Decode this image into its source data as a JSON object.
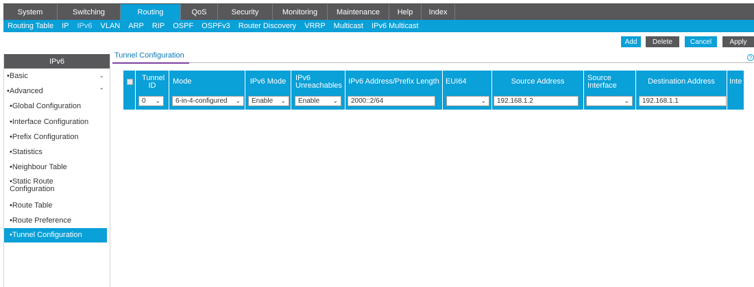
{
  "top_nav": [
    "System",
    "Switching",
    "Routing",
    "QoS",
    "Security",
    "Monitoring",
    "Maintenance",
    "Help",
    "Index"
  ],
  "sub_nav": [
    "Routing Table",
    "IP",
    "IPv6",
    "VLAN",
    "ARP",
    "RIP",
    "OSPF",
    "OSPFv3",
    "Router Discovery",
    "VRRP",
    "Multicast",
    "IPv6 Multicast"
  ],
  "actions": {
    "add": "Add",
    "delete": "Delete",
    "cancel": "Cancel",
    "apply": "Apply"
  },
  "sidebar": {
    "title": "IPv6",
    "groups": [
      "Basic",
      "Advanced"
    ],
    "items": [
      "Global Configuration",
      "Interface Configuration",
      "Prefix Configuration",
      "Statistics",
      "Neighbour Table",
      "Static Route Configuration",
      "Route Table",
      "Route Preference",
      "Tunnel Configuration"
    ]
  },
  "page_tab": "Tunnel Configuration",
  "help_icon": "?",
  "table": {
    "columns": [
      "Tunnel ID",
      "Mode",
      "IPv6 Mode",
      "IPv6 Unreachables",
      "IPv6 Address/Prefix Length",
      "EUI64",
      "Source Address",
      "Source Interface",
      "Destination Address",
      "Inte"
    ],
    "row": {
      "tunnel_id": "0",
      "mode": "6-in-4-configured",
      "ipv6_mode": "Enable",
      "ipv6_unreachables": "Enable",
      "ipv6_address": "2000::2/64",
      "eui64": "",
      "source_address": "192.168.1.2",
      "source_interface": "",
      "destination_address": "192.168.1.1"
    }
  },
  "colors": {
    "accent": "#0aa0d8",
    "nav_dark": "#58585a",
    "tab_underline": "#7b3fa0"
  }
}
